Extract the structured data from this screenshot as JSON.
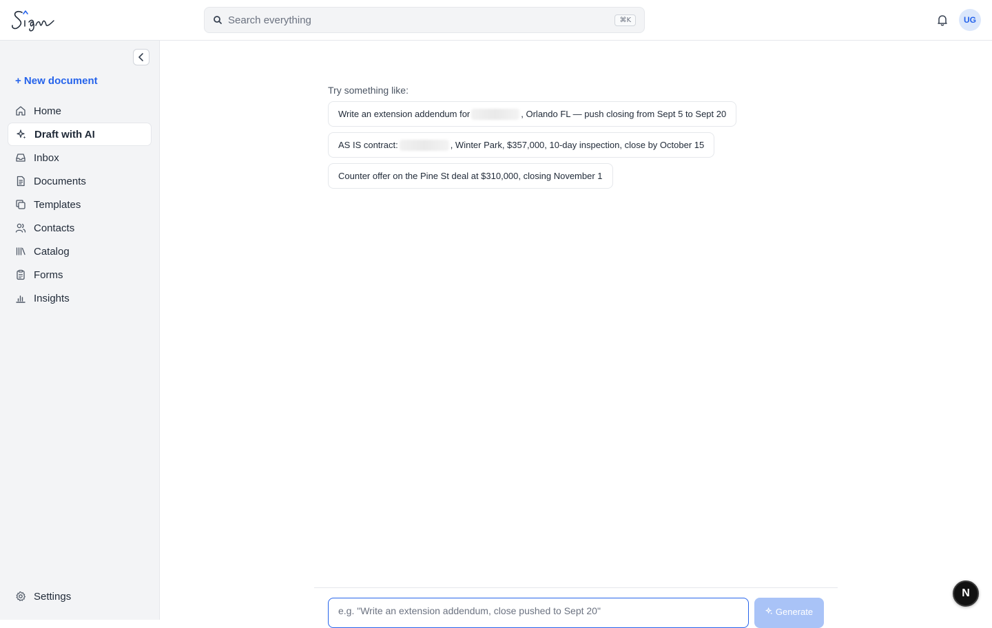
{
  "header": {
    "search_placeholder": "Search everything",
    "search_shortcut": "⌘K",
    "avatar_initials": "UG"
  },
  "sidebar": {
    "new_document_label": "+ New document",
    "items": [
      {
        "label": "Home",
        "icon": "home-icon"
      },
      {
        "label": "Draft with AI",
        "icon": "sparkles-icon",
        "active": true
      },
      {
        "label": "Inbox",
        "icon": "inbox-icon"
      },
      {
        "label": "Documents",
        "icon": "document-icon"
      },
      {
        "label": "Templates",
        "icon": "copy-icon"
      },
      {
        "label": "Contacts",
        "icon": "users-icon"
      },
      {
        "label": "Catalog",
        "icon": "library-icon"
      },
      {
        "label": "Forms",
        "icon": "clipboard-icon"
      },
      {
        "label": "Insights",
        "icon": "bar-chart-icon"
      }
    ],
    "settings_label": "Settings"
  },
  "main": {
    "try_label": "Try something like:",
    "suggestions": [
      {
        "before": "Write an extension addendum for",
        "after": ", Orlando FL — push closing from Sept 5 to Sept 20"
      },
      {
        "before": "AS IS contract:",
        "after": ", Winter Park, $357,000, 10-day inspection, close by October 15"
      },
      {
        "text": "Counter offer on the Pine St deal at $310,000, closing November 1"
      }
    ],
    "prompt_placeholder": "e.g. \"Write an extension addendum, close pushed to Sept 20\"",
    "generate_label": "Generate"
  },
  "fab_label": "N",
  "colors": {
    "accent": "#2563eb",
    "sidebar_bg": "#f3f4f6",
    "generate_disabled": "#a9c3f7"
  }
}
